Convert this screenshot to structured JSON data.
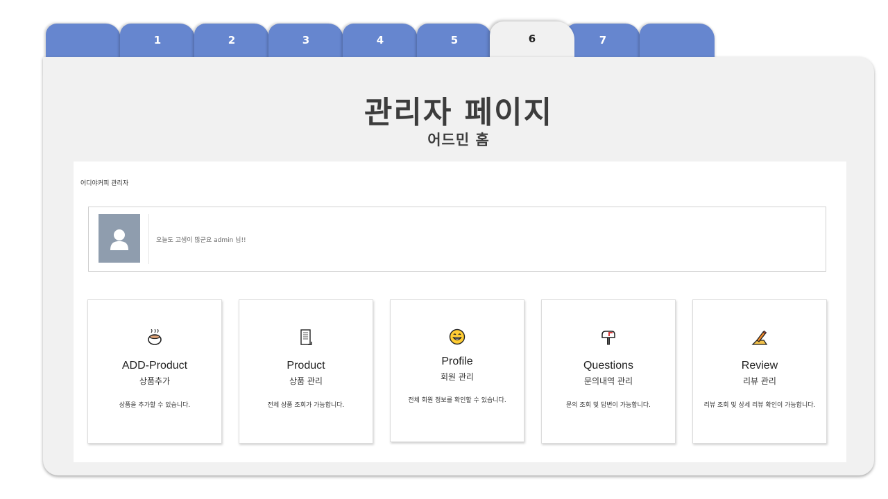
{
  "tabs": [
    {
      "label": ""
    },
    {
      "label": "1"
    },
    {
      "label": "2"
    },
    {
      "label": "3"
    },
    {
      "label": "4"
    },
    {
      "label": "5"
    },
    {
      "label": "6"
    },
    {
      "label": "7"
    },
    {
      "label": ""
    }
  ],
  "active_tab": "6",
  "header": {
    "title": "관리자 페이지",
    "subtitle": "어드민 홈"
  },
  "brand": "어디야커피 관리자",
  "welcome": {
    "message": "오늘도 고생이 많군요 admin 님!!",
    "avatar_icon": "user-silhouette-icon"
  },
  "cards": [
    {
      "icon": "coffee-cup-icon",
      "title": "ADD-Product",
      "subtitle": "상품추가",
      "description": "상품을 추가할 수 있습니다."
    },
    {
      "icon": "document-icon",
      "title": "Product",
      "subtitle": "상품 관리",
      "description": "전체 상품 조회가 가능합니다."
    },
    {
      "icon": "grinning-face-icon",
      "title": "Profile",
      "subtitle": "회원 관리",
      "description": "전체 회원 정보를 확인할 수 있습니다."
    },
    {
      "icon": "mailbox-icon",
      "title": "Questions",
      "subtitle": "문의내역 관리",
      "description": "문의 조회 및 답변이 가능합니다."
    },
    {
      "icon": "pencil-icon",
      "title": "Review",
      "subtitle": "리뷰 관리",
      "description": "리뷰 조회 및 상세 리뷰 확인이 가능합니다."
    }
  ],
  "colors": {
    "tab": "#6686cf",
    "panel": "#f1f1f1",
    "avatar": "#8f9dae"
  }
}
